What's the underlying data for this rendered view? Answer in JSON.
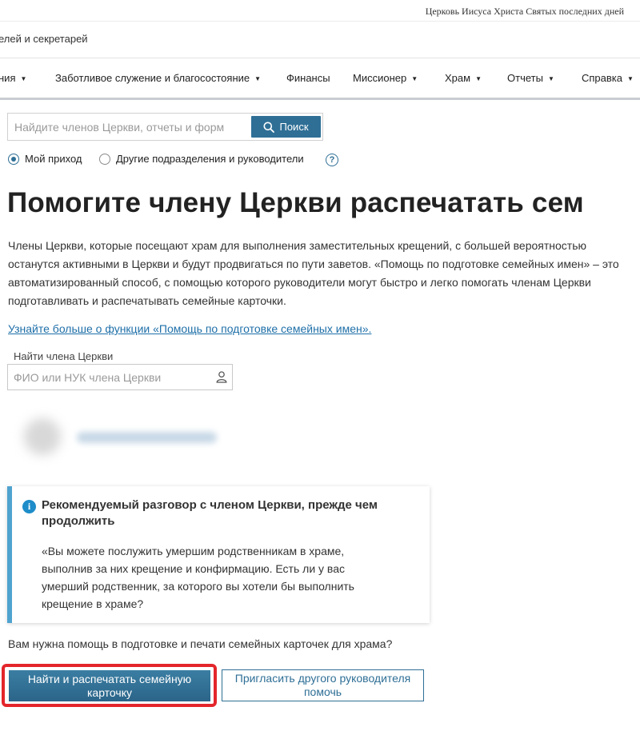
{
  "header": {
    "church_name": "Церковь Иисуса Христа Святых последних дней",
    "subtitle": "елей и секретарей"
  },
  "nav": {
    "items": [
      {
        "label": "ния"
      },
      {
        "label": "Заботливое служение и благосостояние"
      },
      {
        "label": "Финансы"
      },
      {
        "label": "Миссионер"
      },
      {
        "label": "Храм"
      },
      {
        "label": "Отчеты"
      },
      {
        "label": "Справка"
      }
    ]
  },
  "search": {
    "placeholder": "Найдите членов Церкви, отчеты и форм",
    "value": "",
    "button_label": "Поиск"
  },
  "scope": {
    "option_ward": "Мой приход",
    "option_other": "Другие подразделения и руководители",
    "selected": "Мой приход"
  },
  "page": {
    "title": "Помогите члену Церкви распечатать сем",
    "intro": "Члены Церкви, которые посещают храм для выполнения заместительных крещений, с большей вероятностью останутся активными в Церкви и будут продвигаться по пути заветов. «Помощь по подготовке семейных имен» – это автоматизированный способ, с помощью которого руководители могут быстро и легко помогать членам Церкви подготавливать и распечатывать семейные карточки.",
    "learn_more": "Узнайте больше о функции «Помощь по подготовке семейных имен»."
  },
  "member_search": {
    "label": "Найти члена Церкви",
    "placeholder": "ФИО или НУК члена Церкви",
    "value": ""
  },
  "info_card": {
    "title": "Рекомендуемый разговор с членом Церкви, прежде чем продолжить",
    "quote": "«Вы можете послужить умершим родственникам в храме, выполнив за них крещение и конфирмацию. Есть ли у вас умерший родственник, за которого вы хотели бы выполнить крещение в храме?"
  },
  "actions": {
    "question": "Вам нужна помощь в подготовке и печати семейных карточек для храма?",
    "primary_label": "Найти и распечатать семейную карточку",
    "secondary_label": "Пригласить другого руководителя помочь"
  },
  "colors": {
    "accent": "#2f6f96",
    "link": "#1e6fa8",
    "info_border": "#4fa3cf",
    "highlight": "#e3262b"
  }
}
